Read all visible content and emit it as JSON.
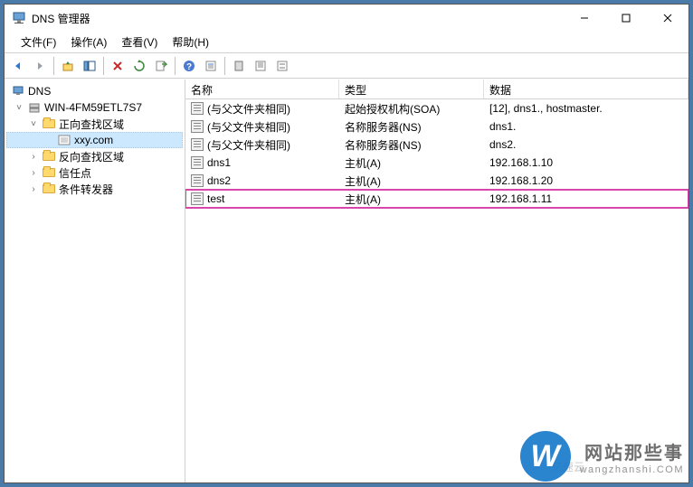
{
  "window": {
    "title": "DNS 管理器"
  },
  "menubar": [
    {
      "label": "文件(F)"
    },
    {
      "label": "操作(A)"
    },
    {
      "label": "查看(V)"
    },
    {
      "label": "帮助(H)"
    }
  ],
  "tree": {
    "root": "DNS",
    "server": "WIN-4FM59ETL7S7",
    "nodes": [
      {
        "label": "正向查找区域",
        "children": [
          {
            "label": "xxy.com",
            "selected": true
          }
        ]
      },
      {
        "label": "反向查找区域"
      },
      {
        "label": "信任点"
      },
      {
        "label": "条件转发器"
      }
    ]
  },
  "columns": {
    "name": "名称",
    "type": "类型",
    "data": "数据"
  },
  "records": [
    {
      "name": "(与父文件夹相同)",
      "type": "起始授权机构(SOA)",
      "data": "[12], dns1., hostmaster."
    },
    {
      "name": "(与父文件夹相同)",
      "type": "名称服务器(NS)",
      "data": "dns1."
    },
    {
      "name": "(与父文件夹相同)",
      "type": "名称服务器(NS)",
      "data": "dns2."
    },
    {
      "name": "dns1",
      "type": "主机(A)",
      "data": "192.168.1.10"
    },
    {
      "name": "dns2",
      "type": "主机(A)",
      "data": "192.168.1.20"
    },
    {
      "name": "test",
      "type": "主机(A)",
      "data": "192.168.1.11",
      "highlighted": true
    }
  ],
  "watermark": {
    "badge": "W",
    "cn": "网站那些事",
    "en": "wangzhanshi.COM",
    "small": "亿速云"
  }
}
